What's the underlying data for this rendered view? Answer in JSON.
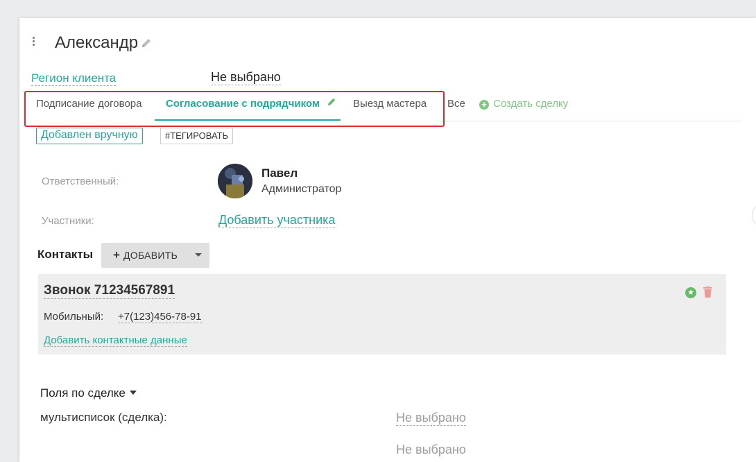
{
  "deal": {
    "title": "Александр",
    "region_label": "Регион клиента",
    "region_value": "Не выбрано"
  },
  "tabs": [
    {
      "label": "Подписание договора",
      "active": false
    },
    {
      "label": "Согласование с подрядчиком",
      "active": true
    },
    {
      "label": "Выезд мастера",
      "active": false
    },
    {
      "label": "Все",
      "active": false
    }
  ],
  "create_deal_label": "Создать сделку",
  "tags": {
    "source": "Добавлен вручную",
    "tag_button": "#ТЕГИРОВАТЬ"
  },
  "responsible": {
    "label": "Ответственный:",
    "name": "Павел",
    "role": "Администратор"
  },
  "participants": {
    "label": "Участники:",
    "add_label": "Добавить участника"
  },
  "contacts": {
    "title": "Контакты",
    "add_button": "ДОБАВИТЬ",
    "items": [
      {
        "name": "Звонок 71234567891",
        "phone_label": "Мобильный:",
        "phone": "+7(123)456-78-91",
        "add_data_label": "Добавить контактные данные"
      }
    ]
  },
  "deal_fields": {
    "title": "Поля по сделке",
    "multilist_label": "мультисписок (сделка):",
    "multilist_value": "Не выбрано",
    "next_value": "Не выбрано"
  },
  "colors": {
    "accent": "#26a69a",
    "highlight": "#e02a2a",
    "create_green": "#81c784",
    "delete_red": "#ef9a9a"
  }
}
